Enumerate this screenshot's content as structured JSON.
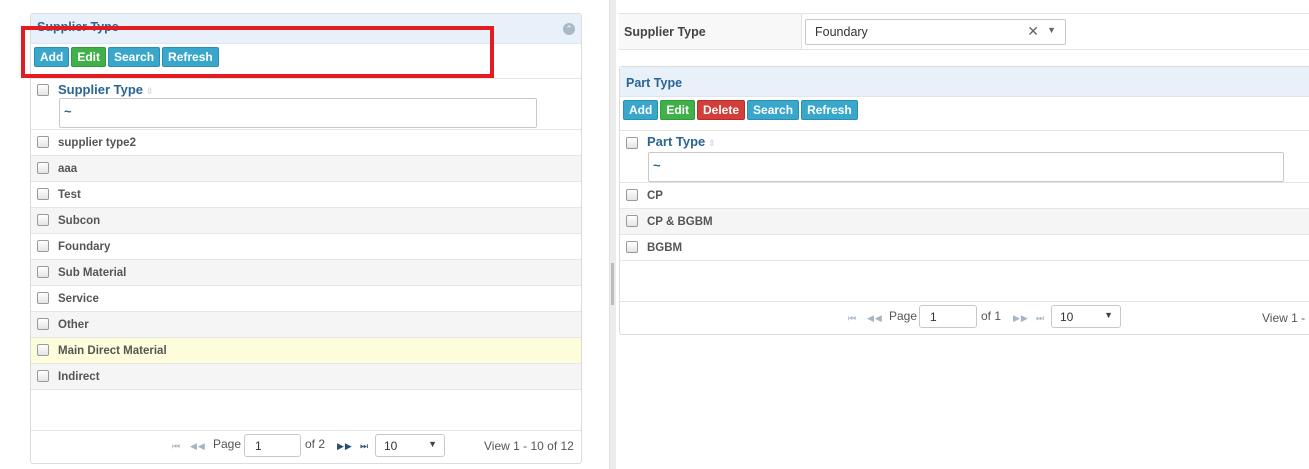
{
  "left": {
    "title": "Supplier Type",
    "buttons": {
      "add": "Add",
      "edit": "Edit",
      "search": "Search",
      "refresh": "Refresh"
    },
    "column": "Supplier Type",
    "filter_value": "~",
    "rows": [
      "supplier type2",
      "aaa",
      "Test",
      "Subcon",
      "Foundary",
      "Sub Material",
      "Service",
      "Other",
      "Main Direct Material",
      "Indirect"
    ],
    "pager": {
      "page_label": "Page",
      "page": "1",
      "of_label": "of 2",
      "per_page": "10",
      "view": "View 1 - 10 of 12"
    }
  },
  "right": {
    "filter_label": "Supplier Type",
    "filter_value": "Foundary",
    "clear_glyph": "✕",
    "title": "Part Type",
    "buttons": {
      "add": "Add",
      "edit": "Edit",
      "delete": "Delete",
      "search": "Search",
      "refresh": "Refresh"
    },
    "column": "Part Type",
    "filter_value_grid": "~",
    "rows": [
      "CP",
      "CP & BGBM",
      "BGBM"
    ],
    "pager": {
      "page_label": "Page",
      "page": "1",
      "of_label": "of 1",
      "per_page": "10",
      "view": "View 1 -"
    }
  },
  "icons": {
    "sort": "sort-icon",
    "first": "first-page-icon",
    "prev": "prev-page-icon",
    "next": "next-page-icon",
    "last": "last-page-icon",
    "collapse": "collapse-icon"
  },
  "colors": {
    "title_bar": "#e8f1f9",
    "blue_btn": "#39a7cc",
    "green_btn": "#41b04a",
    "red_btn": "#d43e3a",
    "highlight": "#e31b23"
  }
}
